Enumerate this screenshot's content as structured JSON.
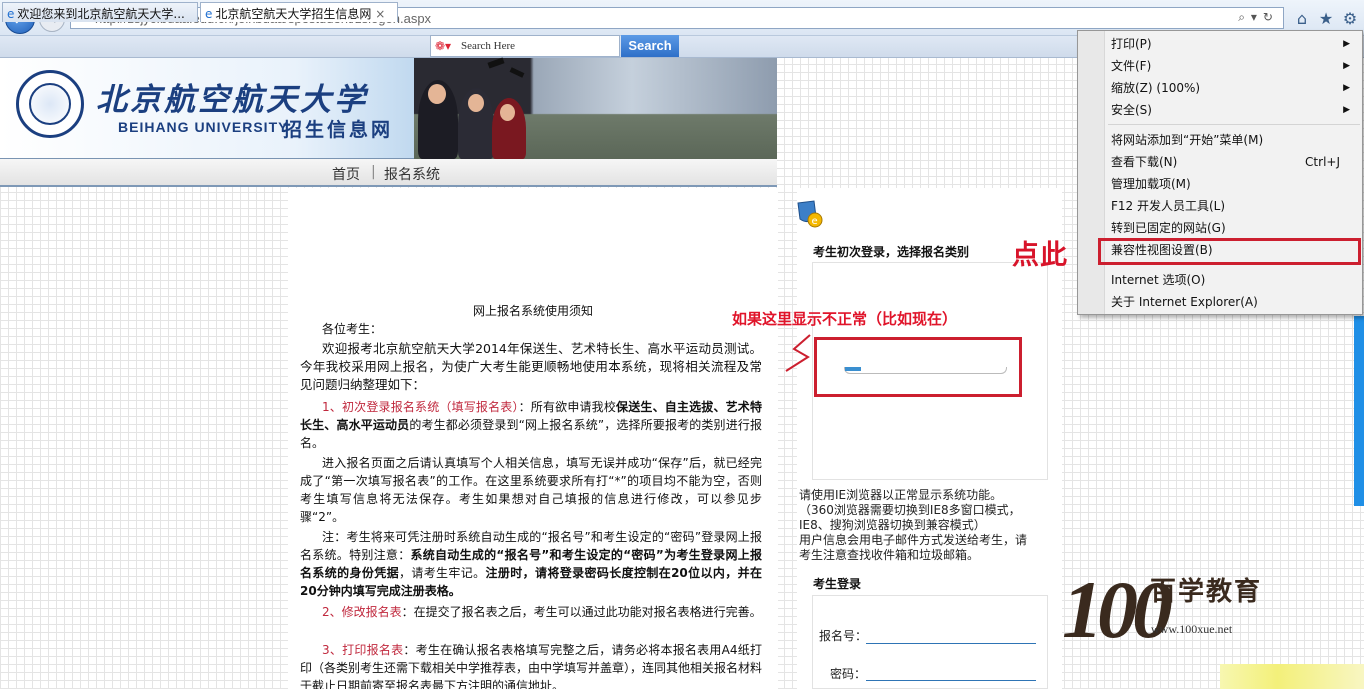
{
  "browser": {
    "url": "http://zsjyc.buaa.edu.cn/joinbuaa/spestudent/zslogon.aspx",
    "tabs": [
      {
        "label": "欢迎您来到北京航空航天大学..."
      },
      {
        "label": "北京航空航天大学招生信息网"
      }
    ],
    "tab_close": "×",
    "search_placeholder": "Search Here",
    "search_button": "Search"
  },
  "site": {
    "school_name_cn": "北京航空航天大学",
    "school_name_en": "BEIHANG UNIVERSITY",
    "site_name": "招生信息网",
    "nav": [
      "首页",
      "报名系统"
    ],
    "nav_separator": "|"
  },
  "notice": {
    "title": "网上报名系统使用须知",
    "greeting": "各位考生：",
    "p1": "欢迎报考北京航空航天大学2014年保送生、艺术特长生、高水平运动员测试。今年我校采用网上报名，为使广大考生能更顺畅地使用本系统，现将相关流程及常见问题归纳整理如下：",
    "s1_head": "1、初次登录报名系统（填写报名表）",
    "s1_a": "：所有欲申请我校",
    "s1_bold": "保送生、自主选拔、艺术特长生、高水平运动员",
    "s1_b": "的考生都必须登录到“网上报名系统”，选择所要报考的类别进行报名。",
    "p2": "进入报名页面之后请认真填写个人相关信息，填写无误并成功“保存”后，就已经完成了“第一次填写报名表”的工作。在这里系统要求所有打“*”的项目均不能为空，否则考生填写信息将无法保存。考生如果想对自己填报的信息进行修改，可以参见步骤“2”。",
    "p3_a": "注：考生将来可凭注册时系统自动生成的“报名号”和考生设定的“密码”登录网上报名系统。特别注意：",
    "p3_bold1": "系统自动生成的“报名号”和考生设定的“密码”为考生登录网上报名系统的身份凭据",
    "p3_b": "，请考生牢记。",
    "p3_bold2": "注册时，请将登录密码长度控制在20位以内，并在20分钟内填写完成注册表格。",
    "s2_head": "2、修改报名表",
    "s2_text": "：在提交了报名表之后，考生可以通过此功能对报名表格进行完善。",
    "s3_head": "3、打印报名表",
    "s3_text": "：考生在确认报名表格填写完整之后，请务必将本报名表用A4纸打印（各类别考生还需下载相关中学推荐表，由中学填写并盖章），连同其他相关报名材料于截止日期前寄至报名表最下方注明的通信地址。"
  },
  "right": {
    "first_login": "考生初次登录，选择报名类别",
    "annotation_hint": "如果这里显示不正常（比如现在）",
    "annotation_click": "点此",
    "loading_progress": 0.1,
    "tips": [
      "请使用IE浏览器以正常显示系统功能。",
      "（360浏览器需要切换到IE8多窗口模式，",
      "IE8、搜狗浏览器切换到兼容模式）",
      "用户信息会用电子邮件方式发送给考生，请",
      "考生注意查找收件箱和垃圾邮箱。"
    ],
    "login_title": "考生登录",
    "reg_no_label": "报名号：",
    "password_label": "密码："
  },
  "watermark": {
    "number": "100",
    "name": "百学教育",
    "url": "www.100xue.net"
  },
  "menu": {
    "items": [
      {
        "label": "打印(P)",
        "submenu": true
      },
      {
        "label": "文件(F)",
        "submenu": true
      },
      {
        "label": "缩放(Z) (100%)",
        "submenu": true
      },
      {
        "label": "安全(S)",
        "submenu": true
      },
      {
        "label": "将网站添加到“开始”菜单(M)"
      },
      {
        "label": "查看下载(N)",
        "shortcut": "Ctrl+J"
      },
      {
        "label": "管理加载项(M)"
      },
      {
        "label": "F12 开发人员工具(L)"
      },
      {
        "label": "转到已固定的网站(G)"
      },
      {
        "label": "兼容性视图设置(B)"
      },
      {
        "label": "Internet 选项(O)"
      },
      {
        "label": "关于 Internet Explorer(A)"
      }
    ],
    "arrow": "▶"
  },
  "colors": {
    "annotation_red": "#cc1f2f",
    "brand_blue": "#1b3f80"
  }
}
